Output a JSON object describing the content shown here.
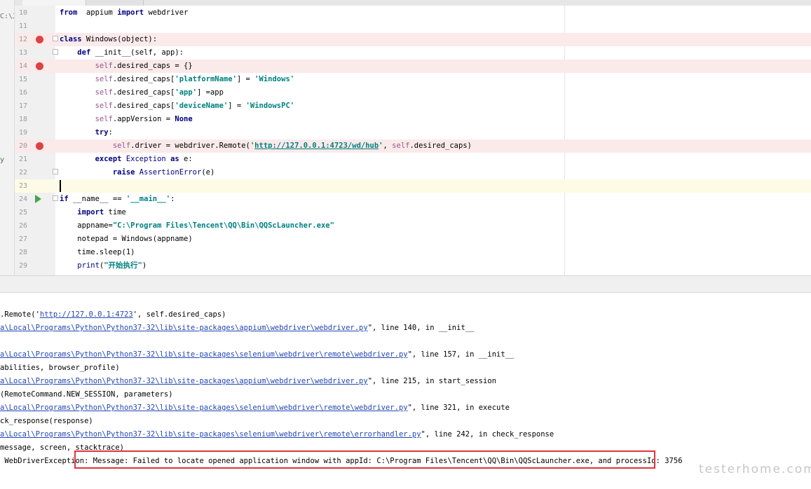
{
  "editor": {
    "left_strip": {
      "path_fragment": "C:\\之",
      "side_char": "y"
    },
    "lines": [
      {
        "n": "10",
        "segs": [
          [
            "kw",
            "from"
          ],
          [
            "",
            "  appium "
          ],
          [
            "kw",
            "import"
          ],
          [
            "",
            " webdriver"
          ]
        ]
      },
      {
        "n": "11",
        "segs": []
      },
      {
        "n": "12",
        "segs": [
          [
            "kw",
            "class"
          ],
          [
            "",
            " Windows(object):"
          ]
        ]
      },
      {
        "n": "13",
        "segs": [
          [
            "",
            "    "
          ],
          [
            "kw",
            "def"
          ],
          [
            "",
            " __init__(self, app):"
          ]
        ]
      },
      {
        "n": "14",
        "segs": [
          [
            "",
            "        "
          ],
          [
            "slf",
            "self"
          ],
          [
            "",
            ".desired_caps = {}"
          ]
        ]
      },
      {
        "n": "15",
        "segs": [
          [
            "",
            "        "
          ],
          [
            "slf",
            "self"
          ],
          [
            "",
            ".desired_caps["
          ],
          [
            "str",
            "'platformName'"
          ],
          [
            "",
            "] = "
          ],
          [
            "str",
            "'Windows'"
          ]
        ]
      },
      {
        "n": "16",
        "segs": [
          [
            "",
            "        "
          ],
          [
            "slf",
            "self"
          ],
          [
            "",
            ".desired_caps["
          ],
          [
            "str",
            "'app'"
          ],
          [
            "",
            "] =app"
          ]
        ]
      },
      {
        "n": "17",
        "segs": [
          [
            "",
            "        "
          ],
          [
            "slf",
            "self"
          ],
          [
            "",
            ".desired_caps["
          ],
          [
            "str",
            "'deviceName'"
          ],
          [
            "",
            "] = "
          ],
          [
            "str",
            "'WindowsPC'"
          ]
        ]
      },
      {
        "n": "18",
        "segs": [
          [
            "",
            "        "
          ],
          [
            "slf",
            "self"
          ],
          [
            "",
            ".appVersion = "
          ],
          [
            "kw",
            "None"
          ]
        ]
      },
      {
        "n": "19",
        "segs": [
          [
            "",
            "        "
          ],
          [
            "kw",
            "try"
          ],
          [
            "",
            ":"
          ]
        ]
      },
      {
        "n": "20",
        "segs": [
          [
            "",
            "            "
          ],
          [
            "slf",
            "self"
          ],
          [
            "",
            ".driver = webdriver.Remote("
          ],
          [
            "str",
            "'"
          ],
          [
            "url",
            "http://127.0.0.1:4723/wd/hub"
          ],
          [
            "str",
            "'"
          ],
          [
            "",
            ", "
          ],
          [
            "slf",
            "self"
          ],
          [
            "",
            ".desired_caps)"
          ]
        ]
      },
      {
        "n": "21",
        "segs": [
          [
            "",
            "        "
          ],
          [
            "kw",
            "except"
          ],
          [
            "",
            " "
          ],
          [
            "bi",
            "Exception"
          ],
          [
            "",
            " "
          ],
          [
            "kw",
            "as"
          ],
          [
            "",
            " e:"
          ]
        ]
      },
      {
        "n": "22",
        "segs": [
          [
            "",
            "            "
          ],
          [
            "kw",
            "raise"
          ],
          [
            "",
            " "
          ],
          [
            "bi",
            "AssertionError"
          ],
          [
            "",
            "(e)"
          ]
        ]
      },
      {
        "n": "23",
        "segs": []
      },
      {
        "n": "24",
        "segs": [
          [
            "kw",
            "if"
          ],
          [
            "",
            " __name__ == "
          ],
          [
            "str",
            "'__main__'"
          ],
          [
            "",
            ":"
          ]
        ]
      },
      {
        "n": "25",
        "segs": [
          [
            "",
            "    "
          ],
          [
            "kw",
            "import"
          ],
          [
            "",
            " time"
          ]
        ]
      },
      {
        "n": "26",
        "segs": [
          [
            "",
            "    appname="
          ],
          [
            "str",
            "\"C:\\Program Files\\Tencent\\QQ\\Bin\\QQScLauncher.exe\""
          ]
        ]
      },
      {
        "n": "27",
        "segs": [
          [
            "",
            "    notepad = Windows(appname)"
          ]
        ]
      },
      {
        "n": "28",
        "segs": [
          [
            "",
            "    time.sleep(1)"
          ]
        ]
      },
      {
        "n": "29",
        "segs": [
          [
            "",
            "    "
          ],
          [
            "bi",
            "print"
          ],
          [
            "",
            "("
          ],
          [
            "str",
            "\"开始执行\""
          ],
          [
            "",
            ")"
          ]
        ]
      }
    ]
  },
  "console": {
    "lines": [
      {
        "segs": [
          [
            "",
            ".Remote('"
          ],
          [
            "link",
            "http://127.0.0.1:4723"
          ],
          [
            "",
            "', self.desired_caps)"
          ]
        ]
      },
      {
        "segs": [
          [
            "link",
            "a\\Local\\Programs\\Python\\Python37-32\\lib\\site-packages\\appium\\webdriver\\webdriver.py"
          ],
          [
            "",
            "\", line 140, in __init__"
          ]
        ]
      },
      {
        "segs": []
      },
      {
        "segs": [
          [
            "link",
            "a\\Local\\Programs\\Python\\Python37-32\\lib\\site-packages\\selenium\\webdriver\\remote\\webdriver.py"
          ],
          [
            "",
            "\", line 157, in __init__"
          ]
        ]
      },
      {
        "segs": [
          [
            "",
            "abilities, browser_profile)"
          ]
        ]
      },
      {
        "segs": [
          [
            "link",
            "a\\Local\\Programs\\Python\\Python37-32\\lib\\site-packages\\appium\\webdriver\\webdriver.py"
          ],
          [
            "",
            "\", line 215, in start_session"
          ]
        ]
      },
      {
        "segs": [
          [
            "",
            "(RemoteCommand.NEW_SESSION, parameters)"
          ]
        ]
      },
      {
        "segs": [
          [
            "link",
            "a\\Local\\Programs\\Python\\Python37-32\\lib\\site-packages\\selenium\\webdriver\\remote\\webdriver.py"
          ],
          [
            "",
            "\", line 321, in execute"
          ]
        ]
      },
      {
        "segs": [
          [
            "",
            "ck_response(response)"
          ]
        ]
      },
      {
        "segs": [
          [
            "link",
            "a\\Local\\Programs\\Python\\Python37-32\\lib\\site-packages\\selenium\\webdriver\\remote\\errorhandler.py"
          ],
          [
            "",
            "\", line 242, in check_response"
          ]
        ]
      },
      {
        "segs": [
          [
            "",
            "message, screen, stacktrace)"
          ]
        ]
      },
      {
        "segs": [
          [
            "err",
            " WebDriverException: Message: Failed to locate opened application window with appId: C:\\Program Files\\Tencent\\QQ\\Bin\\QQScLauncher.exe, and processId: 3756"
          ]
        ]
      }
    ]
  },
  "watermark": "testerhome.com",
  "colors": {
    "breakpoint": "#dc4343",
    "breakpoint_line_bg": "#faeaea",
    "current_line_bg": "#fdfbe6",
    "keyword": "#000080",
    "string": "#008080",
    "self": "#94558d",
    "error_text": "#c0392b",
    "link": "#2347b3",
    "highlight_box": "#e0353a"
  }
}
